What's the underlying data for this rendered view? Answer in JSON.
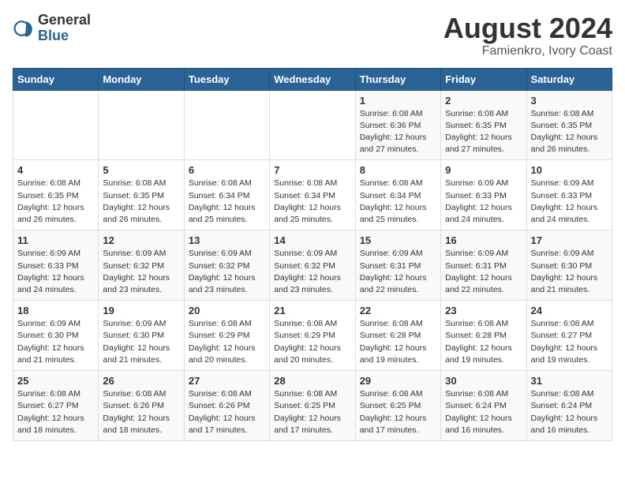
{
  "logo": {
    "line1": "General",
    "line2": "Blue"
  },
  "title": "August 2024",
  "subtitle": "Famienkro, Ivory Coast",
  "days_of_week": [
    "Sunday",
    "Monday",
    "Tuesday",
    "Wednesday",
    "Thursday",
    "Friday",
    "Saturday"
  ],
  "weeks": [
    [
      {
        "num": "",
        "info": ""
      },
      {
        "num": "",
        "info": ""
      },
      {
        "num": "",
        "info": ""
      },
      {
        "num": "",
        "info": ""
      },
      {
        "num": "1",
        "info": "Sunrise: 6:08 AM\nSunset: 6:36 PM\nDaylight: 12 hours\nand 27 minutes."
      },
      {
        "num": "2",
        "info": "Sunrise: 6:08 AM\nSunset: 6:35 PM\nDaylight: 12 hours\nand 27 minutes."
      },
      {
        "num": "3",
        "info": "Sunrise: 6:08 AM\nSunset: 6:35 PM\nDaylight: 12 hours\nand 26 minutes."
      }
    ],
    [
      {
        "num": "4",
        "info": "Sunrise: 6:08 AM\nSunset: 6:35 PM\nDaylight: 12 hours\nand 26 minutes."
      },
      {
        "num": "5",
        "info": "Sunrise: 6:08 AM\nSunset: 6:35 PM\nDaylight: 12 hours\nand 26 minutes."
      },
      {
        "num": "6",
        "info": "Sunrise: 6:08 AM\nSunset: 6:34 PM\nDaylight: 12 hours\nand 25 minutes."
      },
      {
        "num": "7",
        "info": "Sunrise: 6:08 AM\nSunset: 6:34 PM\nDaylight: 12 hours\nand 25 minutes."
      },
      {
        "num": "8",
        "info": "Sunrise: 6:08 AM\nSunset: 6:34 PM\nDaylight: 12 hours\nand 25 minutes."
      },
      {
        "num": "9",
        "info": "Sunrise: 6:09 AM\nSunset: 6:33 PM\nDaylight: 12 hours\nand 24 minutes."
      },
      {
        "num": "10",
        "info": "Sunrise: 6:09 AM\nSunset: 6:33 PM\nDaylight: 12 hours\nand 24 minutes."
      }
    ],
    [
      {
        "num": "11",
        "info": "Sunrise: 6:09 AM\nSunset: 6:33 PM\nDaylight: 12 hours\nand 24 minutes."
      },
      {
        "num": "12",
        "info": "Sunrise: 6:09 AM\nSunset: 6:32 PM\nDaylight: 12 hours\nand 23 minutes."
      },
      {
        "num": "13",
        "info": "Sunrise: 6:09 AM\nSunset: 6:32 PM\nDaylight: 12 hours\nand 23 minutes."
      },
      {
        "num": "14",
        "info": "Sunrise: 6:09 AM\nSunset: 6:32 PM\nDaylight: 12 hours\nand 23 minutes."
      },
      {
        "num": "15",
        "info": "Sunrise: 6:09 AM\nSunset: 6:31 PM\nDaylight: 12 hours\nand 22 minutes."
      },
      {
        "num": "16",
        "info": "Sunrise: 6:09 AM\nSunset: 6:31 PM\nDaylight: 12 hours\nand 22 minutes."
      },
      {
        "num": "17",
        "info": "Sunrise: 6:09 AM\nSunset: 6:30 PM\nDaylight: 12 hours\nand 21 minutes."
      }
    ],
    [
      {
        "num": "18",
        "info": "Sunrise: 6:09 AM\nSunset: 6:30 PM\nDaylight: 12 hours\nand 21 minutes."
      },
      {
        "num": "19",
        "info": "Sunrise: 6:09 AM\nSunset: 6:30 PM\nDaylight: 12 hours\nand 21 minutes."
      },
      {
        "num": "20",
        "info": "Sunrise: 6:08 AM\nSunset: 6:29 PM\nDaylight: 12 hours\nand 20 minutes."
      },
      {
        "num": "21",
        "info": "Sunrise: 6:08 AM\nSunset: 6:29 PM\nDaylight: 12 hours\nand 20 minutes."
      },
      {
        "num": "22",
        "info": "Sunrise: 6:08 AM\nSunset: 6:28 PM\nDaylight: 12 hours\nand 19 minutes."
      },
      {
        "num": "23",
        "info": "Sunrise: 6:08 AM\nSunset: 6:28 PM\nDaylight: 12 hours\nand 19 minutes."
      },
      {
        "num": "24",
        "info": "Sunrise: 6:08 AM\nSunset: 6:27 PM\nDaylight: 12 hours\nand 19 minutes."
      }
    ],
    [
      {
        "num": "25",
        "info": "Sunrise: 6:08 AM\nSunset: 6:27 PM\nDaylight: 12 hours\nand 18 minutes."
      },
      {
        "num": "26",
        "info": "Sunrise: 6:08 AM\nSunset: 6:26 PM\nDaylight: 12 hours\nand 18 minutes."
      },
      {
        "num": "27",
        "info": "Sunrise: 6:08 AM\nSunset: 6:26 PM\nDaylight: 12 hours\nand 17 minutes."
      },
      {
        "num": "28",
        "info": "Sunrise: 6:08 AM\nSunset: 6:25 PM\nDaylight: 12 hours\nand 17 minutes."
      },
      {
        "num": "29",
        "info": "Sunrise: 6:08 AM\nSunset: 6:25 PM\nDaylight: 12 hours\nand 17 minutes."
      },
      {
        "num": "30",
        "info": "Sunrise: 6:08 AM\nSunset: 6:24 PM\nDaylight: 12 hours\nand 16 minutes."
      },
      {
        "num": "31",
        "info": "Sunrise: 6:08 AM\nSunset: 6:24 PM\nDaylight: 12 hours\nand 16 minutes."
      }
    ]
  ]
}
